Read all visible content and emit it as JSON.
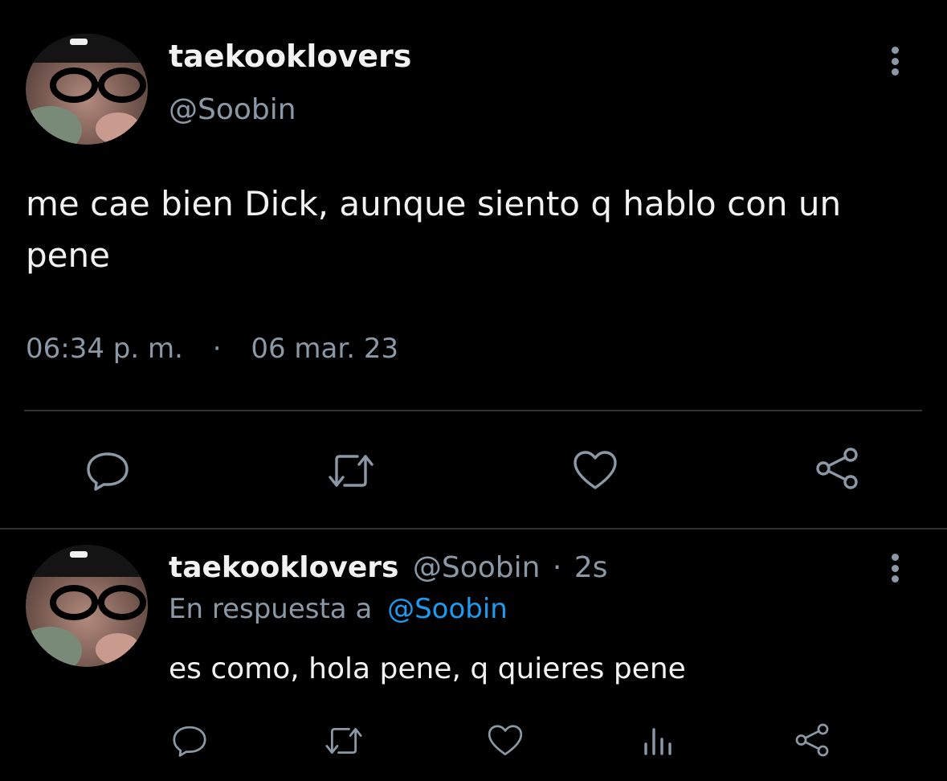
{
  "main_tweet": {
    "display_name": "taekooklovers",
    "handle": "@Soobin",
    "text": "me cae bien Dick, aunque siento q hablo con un pene",
    "time": "06:34 p. m.",
    "separator": "·",
    "date": "06 mar. 23",
    "actions": [
      "reply-icon",
      "retweet-icon",
      "like-icon",
      "share-icon"
    ]
  },
  "reply": {
    "display_name": "taekooklovers",
    "handle": "@Soobin",
    "dot": "·",
    "age": "2s",
    "in_reply_prefix": "En respuesta a",
    "in_reply_handle": "@Soobin",
    "text": "es como, hola pene, q quieres pene",
    "actions": [
      "reply-icon",
      "retweet-icon",
      "like-icon",
      "views-icon",
      "share-icon"
    ]
  },
  "colors": {
    "background": "#000000",
    "text": "#e7e9ea",
    "muted": "#8b98a5",
    "link": "#1d9bf0",
    "divider": "#2f3336"
  }
}
